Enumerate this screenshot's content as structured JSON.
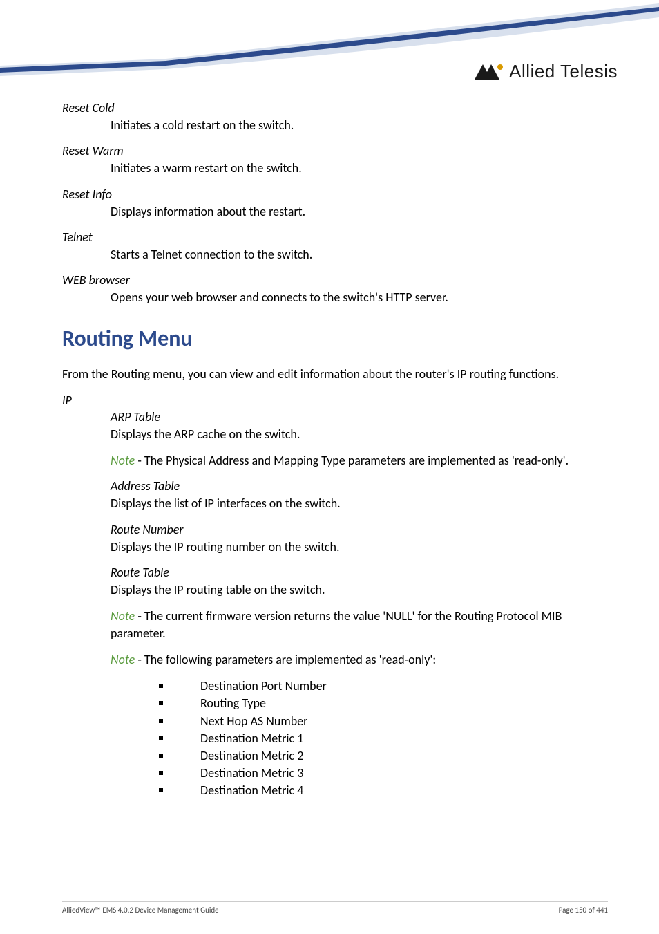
{
  "logo_text": "Allied Telesis",
  "items": [
    {
      "term": "Reset Cold",
      "def": "Initiates a cold restart on the switch."
    },
    {
      "term": "Reset Warm",
      "def": "Initiates a warm restart on the switch."
    },
    {
      "term": "Reset Info",
      "def": "Displays information about the restart."
    },
    {
      "term": "Telnet",
      "def": "Starts a Telnet connection to the switch."
    },
    {
      "term": "WEB browser",
      "def": "Opens your web browser and connects to the switch's HTTP server."
    }
  ],
  "heading": "Routing Menu",
  "intro": "From the Routing menu, you can view and edit information about the router's IP routing functions.",
  "ip_label": "IP",
  "sub": [
    {
      "term": "ARP Table",
      "def": "Displays the ARP cache on the switch."
    }
  ],
  "note1_prefix": "Note",
  "note1_text": " - The Physical Address and Mapping Type parameters are implemented as 'read-only'.",
  "sub2": [
    {
      "term": "Address Table",
      "def": "Displays the list of IP interfaces on the switch."
    },
    {
      "term": "Route Number",
      "def": "Displays the IP routing number on the switch."
    },
    {
      "term": "Route Table",
      "def": "Displays the IP routing table on the switch."
    }
  ],
  "note2_prefix": "Note",
  "note2_text": " - The current firmware version returns the value 'NULL' for the Routing Protocol MIB parameter.",
  "note3_prefix": "Note",
  "note3_text": " - The following parameters are implemented as 'read-only':",
  "bullets": [
    "Destination Port Number",
    "Routing Type",
    "Next Hop AS Number",
    "Destination Metric 1",
    "Destination Metric 2",
    "Destination Metric 3",
    "Destination Metric 4"
  ],
  "footer_left": "AlliedView™-EMS 4.0.2 Device Management Guide",
  "footer_right": "Page 150 of 441"
}
